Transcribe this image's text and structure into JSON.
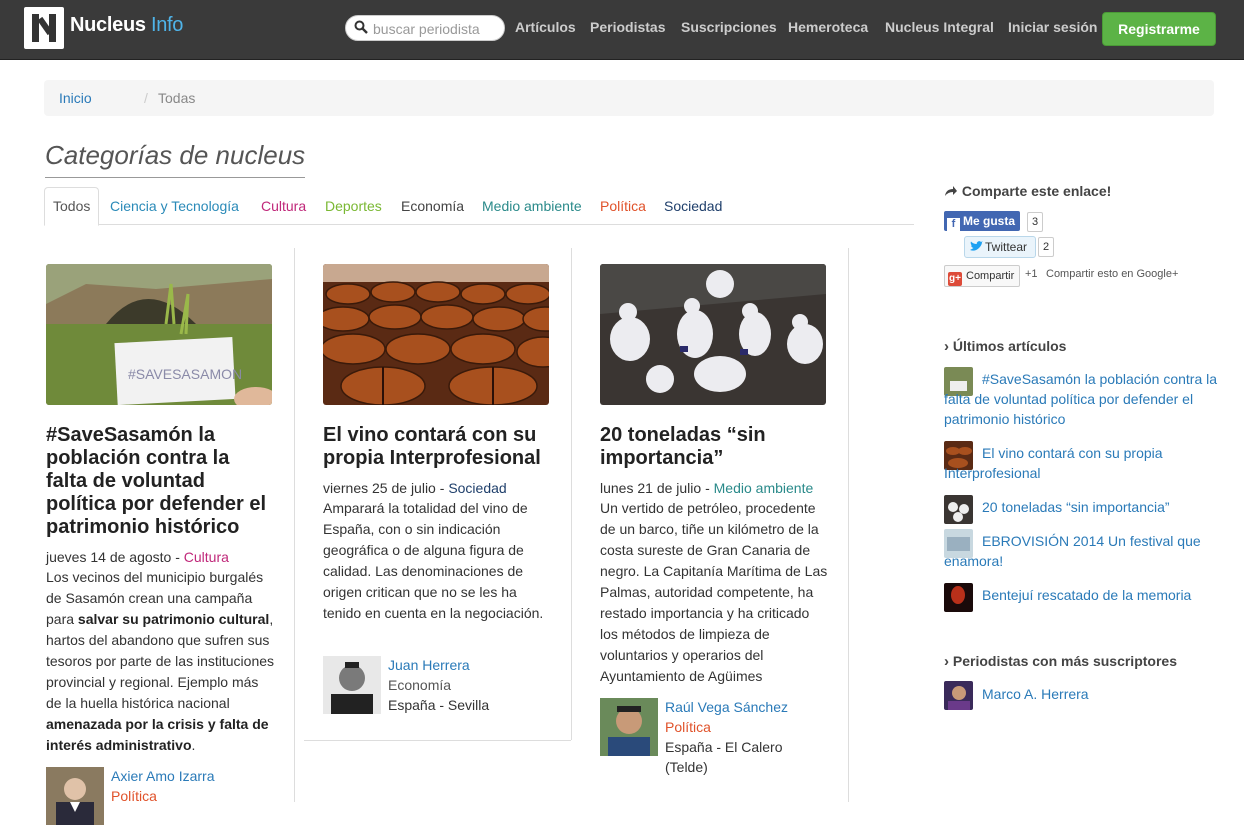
{
  "nav": {
    "brand_1": "Nucleus",
    "brand_2": "Info",
    "search_placeholder": "buscar periodista",
    "links": [
      "Artículos",
      "Periodistas",
      "Suscripciones",
      "Hemeroteca",
      "Nucleus Integral",
      "Iniciar sesión"
    ],
    "register": "Registrarme"
  },
  "breadcrumb": {
    "home": "Inicio",
    "sep": "/",
    "current": "Todas"
  },
  "page_title": "Categorías de nucleus",
  "tabs": [
    {
      "label": "Todos",
      "color": "#555555"
    },
    {
      "label": "Ciencia y Tecnología",
      "color": "#2a8ab8"
    },
    {
      "label": "Cultura",
      "color": "#c0287a"
    },
    {
      "label": "Deportes",
      "color": "#7ab833"
    },
    {
      "label": "Economía",
      "color": "#444444"
    },
    {
      "label": "Medio ambiente",
      "color": "#2a8a8a"
    },
    {
      "label": "Política",
      "color": "#e0522a"
    },
    {
      "label": "Sociedad",
      "color": "#1f3f6b"
    }
  ],
  "articles": [
    {
      "title": "#SaveSasamón la población contra la falta de voluntad política por defender el patrimonio histórico",
      "date": "jueves 14 de agosto",
      "dash": " - ",
      "category": "Cultura",
      "body_1": "Los vecinos del municipio burgalés de Sasamón crean una campaña para ",
      "body_b1": "salvar su patrimonio cultural",
      "body_2": ", hartos del abandono que sufren sus tesoros por parte de las instituciones provincial y regional. Ejemplo más de la huella histórica nacional ",
      "body_b2": "amenazada por la crisis y falta de interés administrativo",
      "body_3": ".",
      "image_text": "#SAVESASAMON",
      "author": "Axier Amo Izarra",
      "author_cat": "Política"
    },
    {
      "title": "El vino contará con su propia Interprofesional",
      "date": "viernes 25 de julio",
      "dash": " - ",
      "category": "Sociedad",
      "body": "Amparará la totalidad del vino de España, con o sin indicación geográfica o de alguna figura de calidad. Las denominaciones de origen critican que no se les ha tenido en cuenta en la negociación.",
      "author": "Juan Herrera",
      "author_cat": "Economía",
      "author_loc": "España - Sevilla"
    },
    {
      "title": "20 toneladas “sin importancia”",
      "date": "lunes 21 de julio",
      "dash": " - ",
      "category": "Medio ambiente",
      "body": "Un vertido de petróleo, procedente de un barco, tiñe un kilómetro de la costa sureste de Gran Canaria de negro. La Capitanía Marítima de Las Palmas, autoridad competente, ha restado importancia y ha criticado los métodos de limpieza de voluntarios y operarios del Ayuntamiento de Agüimes",
      "author": "Raúl Vega Sánchez",
      "author_cat": "Política",
      "author_loc": "España - El Calero (Telde)"
    }
  ],
  "sidebar": {
    "share_title": "Comparte este enlace!",
    "fb_label": "Me gusta",
    "fb_count": "3",
    "tw_label": "Twittear",
    "tw_count": "2",
    "g_label": "Compartir",
    "g_plus": "+1",
    "g_text": "Compartir esto en Google+",
    "latest_title": "Últimos artículos",
    "latest": [
      "#SaveSasamón la población contra la falta de voluntad política por defender el patrimonio histórico",
      "El vino contará con su propia Interprofesional",
      "20 toneladas “sin importancia”",
      "EBROVISIÓN 2014 Un festival que enamora!",
      "Bentejuí rescatado de la memoria"
    ],
    "top_title": "Periodistas con más suscriptores",
    "top": [
      "Marco A. Herrera"
    ]
  }
}
